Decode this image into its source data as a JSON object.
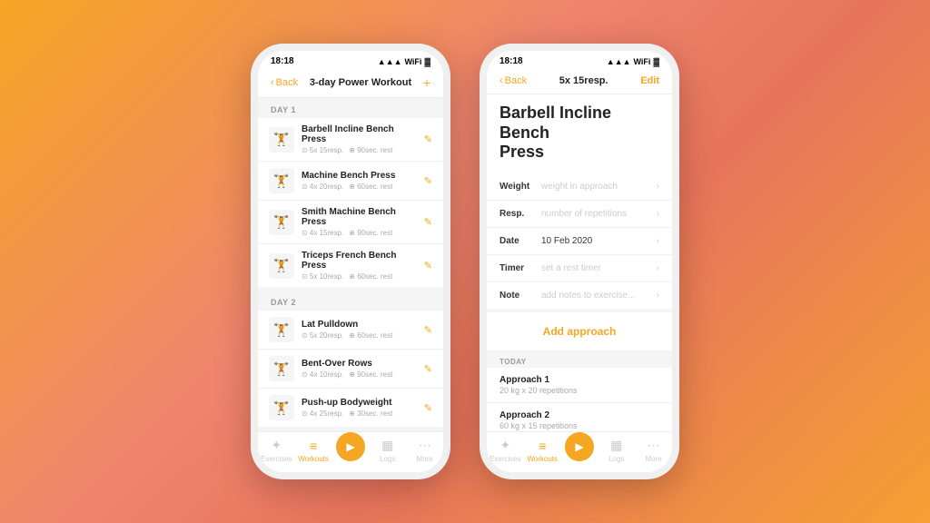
{
  "phone1": {
    "status": {
      "time": "18:18",
      "signal": "▲",
      "wifi": "WiFi",
      "battery": "🔋"
    },
    "nav": {
      "back_label": "Back",
      "title": "3-day Power Workout",
      "action": "+"
    },
    "day1_label": "DAY 1",
    "day2_label": "DAY 2",
    "exercises_day1": [
      {
        "name": "Barbell Incline Bench Press",
        "sets": "5x 15resp.",
        "rest": "90sec. rest",
        "icon": "🏋"
      },
      {
        "name": "Machine Bench Press",
        "sets": "4x 20resp.",
        "rest": "60sec. rest",
        "icon": "🏋"
      },
      {
        "name": "Smith Machine Bench Press",
        "sets": "4x 15resp.",
        "rest": "90sec. rest",
        "icon": "🏋"
      },
      {
        "name": "Triceps French Bench Press",
        "sets": "5x 10resp.",
        "rest": "60sec. rest",
        "icon": "🏋"
      }
    ],
    "exercises_day2": [
      {
        "name": "Lat Pulldown",
        "sets": "5x 20resp.",
        "rest": "60sec. rest",
        "icon": "🏋"
      },
      {
        "name": "Bent-Over Rows",
        "sets": "4x 10resp.",
        "rest": "90sec. rest",
        "icon": "🏋"
      },
      {
        "name": "Push-up Bodyweight",
        "sets": "4x 25resp.",
        "rest": "30sec. rest",
        "icon": "🏋"
      }
    ],
    "tabs": [
      {
        "label": "Exercises",
        "icon": "✦",
        "active": false
      },
      {
        "label": "Workouts",
        "icon": "≡",
        "active": true
      },
      {
        "label": "Play",
        "icon": "▶",
        "active": false
      },
      {
        "label": "Logs",
        "icon": "📋",
        "active": false
      },
      {
        "label": "More",
        "icon": "⋯",
        "active": false
      }
    ]
  },
  "phone2": {
    "status": {
      "time": "18:18",
      "signal": "▲",
      "wifi": "WiFi",
      "battery": "🔋"
    },
    "nav": {
      "back_label": "Back",
      "title": "5x 15resp.",
      "action_label": "Edit"
    },
    "exercise_title": "Barbell Incline Bench\nPress",
    "rows": [
      {
        "label": "Weight",
        "placeholder": "weight in approach",
        "value": "",
        "has_value": false
      },
      {
        "label": "Resp.",
        "placeholder": "number of repetitions",
        "value": "",
        "has_value": false
      },
      {
        "label": "Date",
        "placeholder": "",
        "value": "10 Feb 2020",
        "has_value": true
      },
      {
        "label": "Timer",
        "placeholder": "set a rest timer",
        "value": "",
        "has_value": false
      },
      {
        "label": "Note",
        "placeholder": "add notes to exercise...",
        "value": "",
        "has_value": false
      }
    ],
    "add_approach_label": "Add approach",
    "today_label": "TODAY",
    "approaches": [
      {
        "name": "Approach 1",
        "detail": "20 kg x 20 repetitions"
      },
      {
        "name": "Approach 2",
        "detail": "60 kg x 15 repetitions"
      }
    ],
    "tabs": [
      {
        "label": "Exercises",
        "icon": "✦",
        "active": false
      },
      {
        "label": "Workouts",
        "icon": "≡",
        "active": true
      },
      {
        "label": "Play",
        "icon": "▶",
        "active": false
      },
      {
        "label": "Logs",
        "icon": "📋",
        "active": false
      },
      {
        "label": "More",
        "icon": "⋯",
        "active": false
      }
    ]
  }
}
